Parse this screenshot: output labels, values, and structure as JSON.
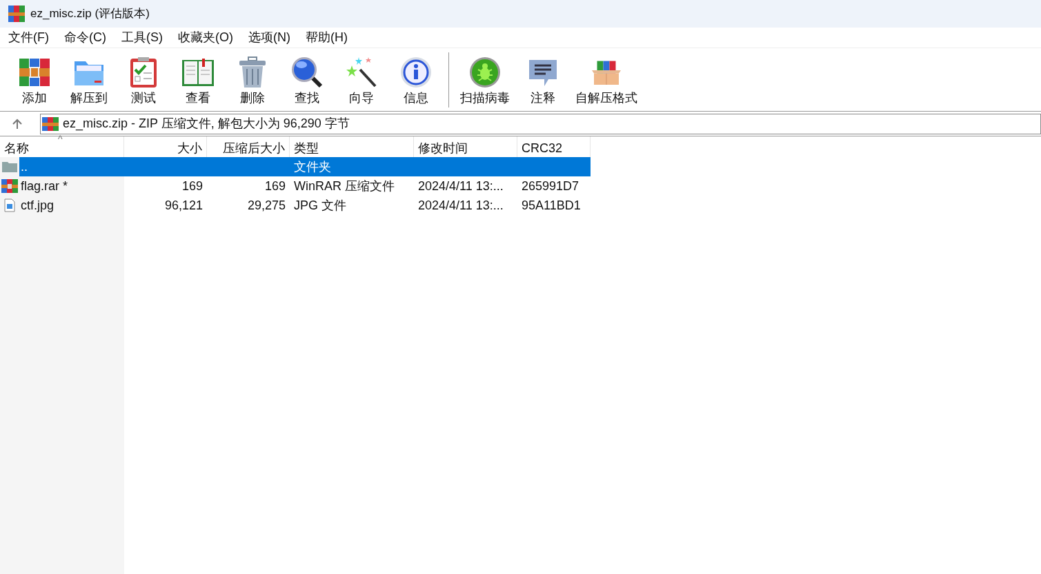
{
  "window": {
    "title": "ez_misc.zip (评估版本)"
  },
  "menu": [
    "文件(F)",
    "命令(C)",
    "工具(S)",
    "收藏夹(O)",
    "选项(N)",
    "帮助(H)"
  ],
  "toolbar": [
    {
      "kind": "add",
      "label": "添加"
    },
    {
      "kind": "extract",
      "label": "解压到"
    },
    {
      "kind": "test",
      "label": "测试"
    },
    {
      "kind": "view",
      "label": "查看"
    },
    {
      "kind": "delete",
      "label": "删除"
    },
    {
      "kind": "find",
      "label": "查找"
    },
    {
      "kind": "wizard",
      "label": "向导"
    },
    {
      "kind": "info",
      "label": "信息"
    },
    {
      "kind": "scan",
      "label": "扫描病毒"
    },
    {
      "kind": "comment",
      "label": "注释"
    },
    {
      "kind": "sfx",
      "label": "自解压格式"
    }
  ],
  "address": {
    "text": "ez_misc.zip - ZIP 压缩文件, 解包大小为 96,290 字节"
  },
  "table": {
    "columns": [
      "名称",
      "大小",
      "压缩后大小",
      "类型",
      "修改时间",
      "CRC32"
    ],
    "sort_caret": "^",
    "rows": [
      {
        "kind": "folder",
        "selected": true,
        "name": "..",
        "size": "",
        "packed": "",
        "type": "文件夹",
        "modified": "",
        "crc": ""
      },
      {
        "kind": "archive",
        "selected": false,
        "name": "flag.rar *",
        "size": "169",
        "packed": "169",
        "type": "WinRAR 压缩文件",
        "modified": "2024/4/11 13:...",
        "crc": "265991D7"
      },
      {
        "kind": "image",
        "selected": false,
        "name": "ctf.jpg",
        "size": "96,121",
        "packed": "29,275",
        "type": "JPG 文件",
        "modified": "2024/4/11 13:...",
        "crc": "95A11BD1"
      }
    ]
  }
}
